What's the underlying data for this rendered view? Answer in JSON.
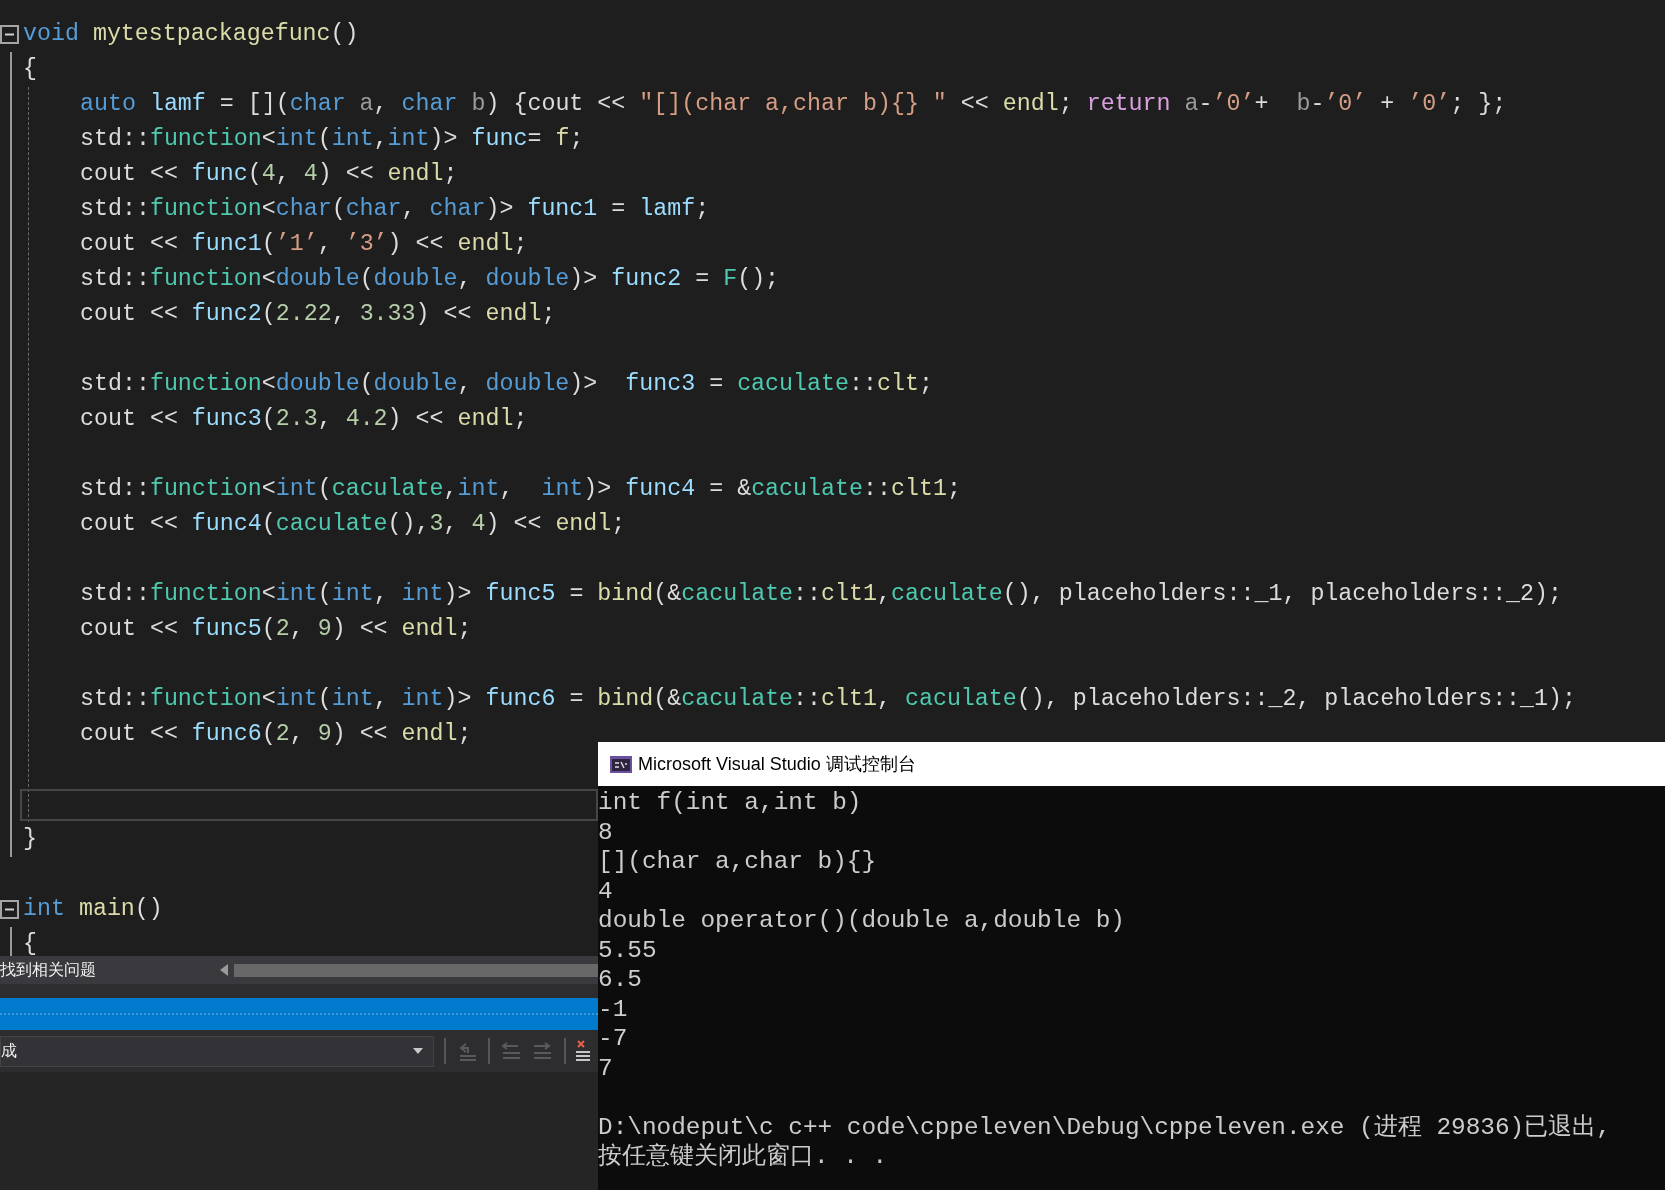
{
  "functions": [
    {
      "expanded": true,
      "signature": [
        {
          "text": "void",
          "kind": "keyword"
        },
        {
          "text": " mytestpackagefunc",
          "kind": "function"
        },
        {
          "text": "()",
          "kind": "plain"
        }
      ],
      "open_brace": "{",
      "body": [
        {
          "kind": "code",
          "tokens": [
            {
              "text": "auto",
              "kind": "keyword"
            },
            {
              "text": " lamf",
              "kind": "variable"
            },
            {
              "text": " = [](",
              "kind": "plain"
            },
            {
              "text": "char",
              "kind": "keyword"
            },
            {
              "text": " a",
              "kind": "param"
            },
            {
              "text": ", ",
              "kind": "plain"
            },
            {
              "text": "char",
              "kind": "keyword"
            },
            {
              "text": " b",
              "kind": "param"
            },
            {
              "text": ") {",
              "kind": "plain"
            },
            {
              "text": "cout << ",
              "kind": "plain"
            },
            {
              "text": "″[](char a,char b){} ″",
              "kind": "string"
            },
            {
              "text": " << ",
              "kind": "plain"
            },
            {
              "text": "endl",
              "kind": "function"
            },
            {
              "text": "; ",
              "kind": "plain"
            },
            {
              "text": "return",
              "kind": "control"
            },
            {
              "text": " a",
              "kind": "param"
            },
            {
              "text": "-",
              "kind": "plain"
            },
            {
              "text": "’0’",
              "kind": "string"
            },
            {
              "text": "+  ",
              "kind": "plain"
            },
            {
              "text": "b",
              "kind": "param"
            },
            {
              "text": "-",
              "kind": "plain"
            },
            {
              "text": "’0’",
              "kind": "string"
            },
            {
              "text": " + ",
              "kind": "plain"
            },
            {
              "text": "’0’",
              "kind": "string"
            },
            {
              "text": "; };",
              "kind": "plain"
            }
          ]
        },
        {
          "kind": "code",
          "tokens": [
            {
              "text": "std::",
              "kind": "plain"
            },
            {
              "text": "function",
              "kind": "type"
            },
            {
              "text": "<",
              "kind": "plain"
            },
            {
              "text": "int",
              "kind": "keyword"
            },
            {
              "text": "(",
              "kind": "plain"
            },
            {
              "text": "int",
              "kind": "keyword"
            },
            {
              "text": ",",
              "kind": "plain"
            },
            {
              "text": "int",
              "kind": "keyword"
            },
            {
              "text": ")> ",
              "kind": "plain"
            },
            {
              "text": "func",
              "kind": "variable"
            },
            {
              "text": "= ",
              "kind": "plain"
            },
            {
              "text": "f",
              "kind": "function"
            },
            {
              "text": ";",
              "kind": "plain"
            }
          ]
        },
        {
          "kind": "code",
          "tokens": [
            {
              "text": "cout << ",
              "kind": "plain"
            },
            {
              "text": "func",
              "kind": "variable"
            },
            {
              "text": "(",
              "kind": "plain"
            },
            {
              "text": "4",
              "kind": "number"
            },
            {
              "text": ", ",
              "kind": "plain"
            },
            {
              "text": "4",
              "kind": "number"
            },
            {
              "text": ") << ",
              "kind": "plain"
            },
            {
              "text": "endl",
              "kind": "function"
            },
            {
              "text": ";",
              "kind": "plain"
            }
          ]
        },
        {
          "kind": "code",
          "tokens": [
            {
              "text": "std::",
              "kind": "plain"
            },
            {
              "text": "function",
              "kind": "type"
            },
            {
              "text": "<",
              "kind": "plain"
            },
            {
              "text": "char",
              "kind": "keyword"
            },
            {
              "text": "(",
              "kind": "plain"
            },
            {
              "text": "char",
              "kind": "keyword"
            },
            {
              "text": ", ",
              "kind": "plain"
            },
            {
              "text": "char",
              "kind": "keyword"
            },
            {
              "text": ")> ",
              "kind": "plain"
            },
            {
              "text": "func1",
              "kind": "variable"
            },
            {
              "text": " = ",
              "kind": "plain"
            },
            {
              "text": "lamf",
              "kind": "variable"
            },
            {
              "text": ";",
              "kind": "plain"
            }
          ]
        },
        {
          "kind": "code",
          "tokens": [
            {
              "text": "cout << ",
              "kind": "plain"
            },
            {
              "text": "func1",
              "kind": "variable"
            },
            {
              "text": "(",
              "kind": "plain"
            },
            {
              "text": "’1’",
              "kind": "string"
            },
            {
              "text": ", ",
              "kind": "plain"
            },
            {
              "text": "’3’",
              "kind": "string"
            },
            {
              "text": ") << ",
              "kind": "plain"
            },
            {
              "text": "endl",
              "kind": "function"
            },
            {
              "text": ";",
              "kind": "plain"
            }
          ]
        },
        {
          "kind": "code",
          "tokens": [
            {
              "text": "std::",
              "kind": "plain"
            },
            {
              "text": "function",
              "kind": "type"
            },
            {
              "text": "<",
              "kind": "plain"
            },
            {
              "text": "double",
              "kind": "keyword"
            },
            {
              "text": "(",
              "kind": "plain"
            },
            {
              "text": "double",
              "kind": "keyword"
            },
            {
              "text": ", ",
              "kind": "plain"
            },
            {
              "text": "double",
              "kind": "keyword"
            },
            {
              "text": ")> ",
              "kind": "plain"
            },
            {
              "text": "func2",
              "kind": "variable"
            },
            {
              "text": " = ",
              "kind": "plain"
            },
            {
              "text": "F",
              "kind": "type"
            },
            {
              "text": "();",
              "kind": "plain"
            }
          ]
        },
        {
          "kind": "code",
          "tokens": [
            {
              "text": "cout << ",
              "kind": "plain"
            },
            {
              "text": "func2",
              "kind": "variable"
            },
            {
              "text": "(",
              "kind": "plain"
            },
            {
              "text": "2.22",
              "kind": "number"
            },
            {
              "text": ", ",
              "kind": "plain"
            },
            {
              "text": "3.33",
              "kind": "number"
            },
            {
              "text": ") << ",
              "kind": "plain"
            },
            {
              "text": "endl",
              "kind": "function"
            },
            {
              "text": ";",
              "kind": "plain"
            }
          ]
        },
        {
          "kind": "blank"
        },
        {
          "kind": "code",
          "tokens": [
            {
              "text": "std::",
              "kind": "plain"
            },
            {
              "text": "function",
              "kind": "type"
            },
            {
              "text": "<",
              "kind": "plain"
            },
            {
              "text": "double",
              "kind": "keyword"
            },
            {
              "text": "(",
              "kind": "plain"
            },
            {
              "text": "double",
              "kind": "keyword"
            },
            {
              "text": ", ",
              "kind": "plain"
            },
            {
              "text": "double",
              "kind": "keyword"
            },
            {
              "text": ")>  ",
              "kind": "plain"
            },
            {
              "text": "func3",
              "kind": "variable"
            },
            {
              "text": " = ",
              "kind": "plain"
            },
            {
              "text": "caculate",
              "kind": "type"
            },
            {
              "text": "::",
              "kind": "plain"
            },
            {
              "text": "clt",
              "kind": "function"
            },
            {
              "text": ";",
              "kind": "plain"
            }
          ]
        },
        {
          "kind": "code",
          "tokens": [
            {
              "text": "cout << ",
              "kind": "plain"
            },
            {
              "text": "func3",
              "kind": "variable"
            },
            {
              "text": "(",
              "kind": "plain"
            },
            {
              "text": "2.3",
              "kind": "number"
            },
            {
              "text": ", ",
              "kind": "plain"
            },
            {
              "text": "4.2",
              "kind": "number"
            },
            {
              "text": ") << ",
              "kind": "plain"
            },
            {
              "text": "endl",
              "kind": "function"
            },
            {
              "text": ";",
              "kind": "plain"
            }
          ]
        },
        {
          "kind": "blank"
        },
        {
          "kind": "code",
          "tokens": [
            {
              "text": "std::",
              "kind": "plain"
            },
            {
              "text": "function",
              "kind": "type"
            },
            {
              "text": "<",
              "kind": "plain"
            },
            {
              "text": "int",
              "kind": "keyword"
            },
            {
              "text": "(",
              "kind": "plain"
            },
            {
              "text": "caculate",
              "kind": "type"
            },
            {
              "text": ",",
              "kind": "plain"
            },
            {
              "text": "int",
              "kind": "keyword"
            },
            {
              "text": ",  ",
              "kind": "plain"
            },
            {
              "text": "int",
              "kind": "keyword"
            },
            {
              "text": ")> ",
              "kind": "plain"
            },
            {
              "text": "func4",
              "kind": "variable"
            },
            {
              "text": " = &",
              "kind": "plain"
            },
            {
              "text": "caculate",
              "kind": "type"
            },
            {
              "text": "::",
              "kind": "plain"
            },
            {
              "text": "clt1",
              "kind": "function"
            },
            {
              "text": ";",
              "kind": "plain"
            }
          ]
        },
        {
          "kind": "code",
          "tokens": [
            {
              "text": "cout << ",
              "kind": "plain"
            },
            {
              "text": "func4",
              "kind": "variable"
            },
            {
              "text": "(",
              "kind": "plain"
            },
            {
              "text": "caculate",
              "kind": "type"
            },
            {
              "text": "(),",
              "kind": "plain"
            },
            {
              "text": "3",
              "kind": "number"
            },
            {
              "text": ", ",
              "kind": "plain"
            },
            {
              "text": "4",
              "kind": "number"
            },
            {
              "text": ") << ",
              "kind": "plain"
            },
            {
              "text": "endl",
              "kind": "function"
            },
            {
              "text": ";",
              "kind": "plain"
            }
          ]
        },
        {
          "kind": "blank"
        },
        {
          "kind": "code",
          "tokens": [
            {
              "text": "std::",
              "kind": "plain"
            },
            {
              "text": "function",
              "kind": "type"
            },
            {
              "text": "<",
              "kind": "plain"
            },
            {
              "text": "int",
              "kind": "keyword"
            },
            {
              "text": "(",
              "kind": "plain"
            },
            {
              "text": "int",
              "kind": "keyword"
            },
            {
              "text": ", ",
              "kind": "plain"
            },
            {
              "text": "int",
              "kind": "keyword"
            },
            {
              "text": ")> ",
              "kind": "plain"
            },
            {
              "text": "func5",
              "kind": "variable"
            },
            {
              "text": " = ",
              "kind": "plain"
            },
            {
              "text": "bind",
              "kind": "function"
            },
            {
              "text": "(&",
              "kind": "plain"
            },
            {
              "text": "caculate",
              "kind": "type"
            },
            {
              "text": "::",
              "kind": "plain"
            },
            {
              "text": "clt1",
              "kind": "function"
            },
            {
              "text": ",",
              "kind": "plain"
            },
            {
              "text": "caculate",
              "kind": "type"
            },
            {
              "text": "(), placeholders::_1, placeholders::_2);",
              "kind": "plain"
            }
          ]
        },
        {
          "kind": "code",
          "tokens": [
            {
              "text": "cout << ",
              "kind": "plain"
            },
            {
              "text": "func5",
              "kind": "variable"
            },
            {
              "text": "(",
              "kind": "plain"
            },
            {
              "text": "2",
              "kind": "number"
            },
            {
              "text": ", ",
              "kind": "plain"
            },
            {
              "text": "9",
              "kind": "number"
            },
            {
              "text": ") << ",
              "kind": "plain"
            },
            {
              "text": "endl",
              "kind": "function"
            },
            {
              "text": ";",
              "kind": "plain"
            }
          ]
        },
        {
          "kind": "blank"
        },
        {
          "kind": "code",
          "tokens": [
            {
              "text": "std::",
              "kind": "plain"
            },
            {
              "text": "function",
              "kind": "type"
            },
            {
              "text": "<",
              "kind": "plain"
            },
            {
              "text": "int",
              "kind": "keyword"
            },
            {
              "text": "(",
              "kind": "plain"
            },
            {
              "text": "int",
              "kind": "keyword"
            },
            {
              "text": ", ",
              "kind": "plain"
            },
            {
              "text": "int",
              "kind": "keyword"
            },
            {
              "text": ")> ",
              "kind": "plain"
            },
            {
              "text": "func6",
              "kind": "variable"
            },
            {
              "text": " = ",
              "kind": "plain"
            },
            {
              "text": "bind",
              "kind": "function"
            },
            {
              "text": "(&",
              "kind": "plain"
            },
            {
              "text": "caculate",
              "kind": "type"
            },
            {
              "text": "::",
              "kind": "plain"
            },
            {
              "text": "clt1",
              "kind": "function"
            },
            {
              "text": ", ",
              "kind": "plain"
            },
            {
              "text": "caculate",
              "kind": "type"
            },
            {
              "text": "(), placeholders::_2, placeholders::_1);",
              "kind": "plain"
            }
          ]
        },
        {
          "kind": "code",
          "tokens": [
            {
              "text": "cout << ",
              "kind": "plain"
            },
            {
              "text": "func6",
              "kind": "variable"
            },
            {
              "text": "(",
              "kind": "plain"
            },
            {
              "text": "2",
              "kind": "number"
            },
            {
              "text": ", ",
              "kind": "plain"
            },
            {
              "text": "9",
              "kind": "number"
            },
            {
              "text": ") << ",
              "kind": "plain"
            },
            {
              "text": "endl",
              "kind": "function"
            },
            {
              "text": ";",
              "kind": "plain"
            }
          ]
        },
        {
          "kind": "blank"
        },
        {
          "kind": "current"
        }
      ],
      "close_brace": "}"
    },
    {
      "expanded": true,
      "signature": [
        {
          "text": "int",
          "kind": "keyword"
        },
        {
          "text": " main",
          "kind": "function"
        },
        {
          "text": "()",
          "kind": "plain"
        }
      ],
      "open_brace": "{"
    }
  ],
  "problems_bar": {
    "text": "找到相关问题"
  },
  "output_toolbar": {
    "source": "成"
  },
  "console": {
    "title": "Microsoft Visual Studio 调试控制台",
    "output": [
      "int f(int a,int b)",
      "8",
      "[](char a,char b){}",
      "4",
      "double operator()(double a,double b)",
      "5.55",
      "6.5",
      "-1",
      "-7",
      "7"
    ],
    "exit_message": [
      "D:\\nodeput\\c c++ code\\cppeleven\\Debug\\cppeleven.exe (进程 29836)已退出,",
      "按任意键关闭此窗口. . ."
    ]
  }
}
